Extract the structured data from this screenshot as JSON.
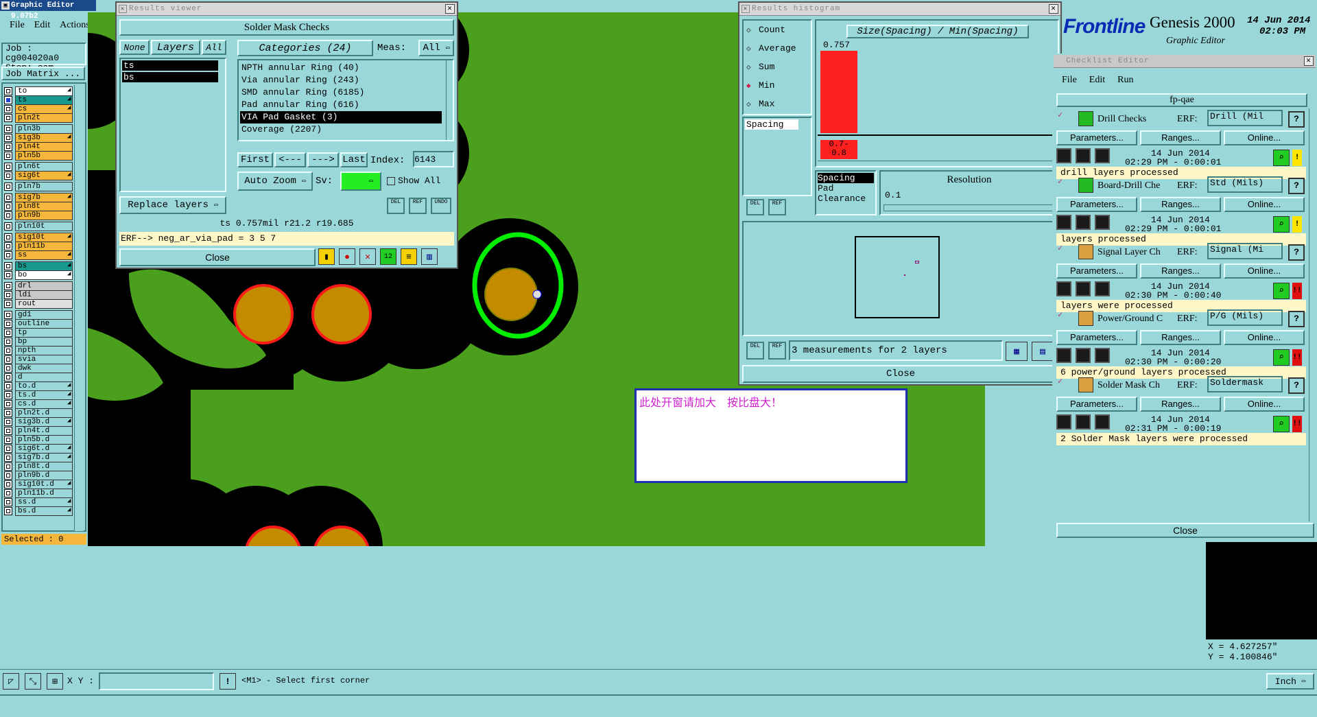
{
  "main_window": {
    "title": "Graphic Editor 9.07b2",
    "menu": [
      "File",
      "Edit",
      "Actions"
    ],
    "job_label": "Job : cg004020a0",
    "step_label": "Step: cam",
    "job_matrix_button": "Job Matrix ...",
    "selected_text": "Selected : 0",
    "layers": [
      {
        "name": "to",
        "bg": "#ffffff",
        "arrow": true
      },
      {
        "name": "ts",
        "bg": "#199a8f",
        "arrow": true,
        "active": true
      },
      {
        "name": "cs",
        "bg": "#f5b73b",
        "arrow": true
      },
      {
        "name": "pln2t",
        "bg": "#f5b73b",
        "arrow": false
      },
      {
        "name": "pln3b",
        "bg": "#9ad7d9",
        "arrow": false
      },
      {
        "name": "sig3b",
        "bg": "#f5b73b",
        "arrow": true
      },
      {
        "name": "pln4t",
        "bg": "#f5b73b",
        "arrow": false
      },
      {
        "name": "pln5b",
        "bg": "#f5b73b",
        "arrow": false
      },
      {
        "name": "pln6t",
        "bg": "#9ad7d9",
        "arrow": false
      },
      {
        "name": "sig6t",
        "bg": "#f5b73b",
        "arrow": true
      },
      {
        "name": "pln7b",
        "bg": "#9ad7d9",
        "arrow": false
      },
      {
        "name": "sig7b",
        "bg": "#f5b73b",
        "arrow": true
      },
      {
        "name": "pln8t",
        "bg": "#f5b73b",
        "arrow": false
      },
      {
        "name": "pln9b",
        "bg": "#f5b73b",
        "arrow": false
      },
      {
        "name": "pln10t",
        "bg": "#9ad7d9",
        "arrow": false
      },
      {
        "name": "sig10t",
        "bg": "#f5b73b",
        "arrow": true
      },
      {
        "name": "pln11b",
        "bg": "#f5b73b",
        "arrow": false
      },
      {
        "name": "ss",
        "bg": "#f5b73b",
        "arrow": true
      },
      {
        "name": "bs",
        "bg": "#199a8f",
        "arrow": true
      },
      {
        "name": "bo",
        "bg": "#ffffff",
        "arrow": true
      },
      {
        "name": "drl",
        "bg": "#c8c8c8",
        "arrow": false
      },
      {
        "name": "ldi",
        "bg": "#c8c8c8",
        "arrow": false
      },
      {
        "name": "rout",
        "bg": "#e0e0e0",
        "arrow": false
      },
      {
        "name": "gd1",
        "bg": "#9ad7d9",
        "arrow": false
      },
      {
        "name": "outline",
        "bg": "#9ad7d9",
        "arrow": false
      },
      {
        "name": "tp",
        "bg": "#9ad7d9",
        "arrow": false
      },
      {
        "name": "bp",
        "bg": "#9ad7d9",
        "arrow": false
      },
      {
        "name": "npth",
        "bg": "#9ad7d9",
        "arrow": false
      },
      {
        "name": "svia",
        "bg": "#9ad7d9",
        "arrow": false
      },
      {
        "name": "dwk",
        "bg": "#9ad7d9",
        "arrow": false
      },
      {
        "name": "d",
        "bg": "#9ad7d9",
        "arrow": false
      },
      {
        "name": "to.d",
        "bg": "#9ad7d9",
        "arrow": true
      },
      {
        "name": "ts.d",
        "bg": "#9ad7d9",
        "arrow": true
      },
      {
        "name": "cs.d",
        "bg": "#9ad7d9",
        "arrow": true
      },
      {
        "name": "pln2t.d",
        "bg": "#9ad7d9",
        "arrow": false
      },
      {
        "name": "sig3b.d",
        "bg": "#9ad7d9",
        "arrow": true
      },
      {
        "name": "pln4t.d",
        "bg": "#9ad7d9",
        "arrow": false
      },
      {
        "name": "pln5b.d",
        "bg": "#9ad7d9",
        "arrow": false
      },
      {
        "name": "sig6t.d",
        "bg": "#9ad7d9",
        "arrow": true
      },
      {
        "name": "sig7b.d",
        "bg": "#9ad7d9",
        "arrow": true
      },
      {
        "name": "pln8t.d",
        "bg": "#9ad7d9",
        "arrow": false
      },
      {
        "name": "pln9b.d",
        "bg": "#9ad7d9",
        "arrow": false
      },
      {
        "name": "sig10t.d",
        "bg": "#9ad7d9",
        "arrow": true
      },
      {
        "name": "pln11b.d",
        "bg": "#9ad7d9",
        "arrow": false
      },
      {
        "name": "ss.d",
        "bg": "#9ad7d9",
        "arrow": true
      },
      {
        "name": "bs.d",
        "bg": "#9ad7d9",
        "arrow": true
      }
    ]
  },
  "bottom_bar": {
    "xy_label": "X Y :",
    "xy_value": "",
    "prompt": "<M1> - Select first corner",
    "units": "Inch"
  },
  "coords": {
    "x": "X = 4.627257\"",
    "y": "Y = 4.100846\""
  },
  "brand": {
    "logo": "Frontline",
    "product": "Genesis 2000",
    "subtitle": "Graphic Editor",
    "date": "14 Jun 2014",
    "time": "02:03 PM"
  },
  "annotation": "此处开窗请加大　按比盘大！",
  "results_viewer": {
    "title": "Results viewer",
    "heading": "Solder Mask Checks",
    "none_btn": "None",
    "layers_btn": "Layers",
    "all_btn": "All",
    "categories_label": "Categories (24)",
    "meas_label": "Meas:",
    "meas_value": "All",
    "layer_list": [
      "ts",
      "bs"
    ],
    "categories": [
      "NPTH annular Ring (40)",
      "Via annular Ring (243)",
      "SMD annular Ring (6185)",
      "Pad annular Ring (616)",
      "VIA Pad Gasket (3)",
      "Coverage (2207)"
    ],
    "selected_category": 4,
    "replace_layers": "Replace layers",
    "first": "First",
    "prev": "<---",
    "next": "--->",
    "last": "Last",
    "index_label": "Index:",
    "index_value": "6143",
    "auto_zoom": "Auto Zoom",
    "sv_label": "Sv:",
    "show_all": "Show All",
    "icon_labels": [
      "DEL",
      "REF",
      "UNDO"
    ],
    "status": "ts 0.757mil   r21.2  r19.685",
    "erf": "ERF--> neg_ar_via_pad = 3 5 7",
    "close": "Close"
  },
  "histogram": {
    "title": "Results histogram",
    "options": [
      "Count",
      "Average",
      "Sum",
      "Min",
      "Max"
    ],
    "selected_option": "Min",
    "chart_title": "Size(Spacing) / Min(Spacing)",
    "bar_value": "0.757",
    "bar_range": "0.7-\n0.8",
    "left_list": [
      "Spacing"
    ],
    "size_list": [
      "Spacing",
      "Pad",
      "Clearance"
    ],
    "resolution_label": "Resolution",
    "resolution_value": "0.1",
    "measurements": "3 measurements for 2 layers",
    "icon_labels": [
      "DEL",
      "REF"
    ],
    "close": "Close",
    "bar_color": "#ff2020"
  },
  "checklist": {
    "title": "Checklist Editor",
    "menu": [
      "File",
      "Edit",
      "Run"
    ],
    "name": "fp-qae",
    "erf_label": "ERF:",
    "params": "Parameters...",
    "ranges": "Ranges...",
    "online": "Online...",
    "items": [
      {
        "name": "Drill Checks",
        "erf": "Drill (Mil",
        "date": "14 Jun 2014",
        "time": "02:29 PM - 0:00:01",
        "msg": "drill layers processed",
        "flag": "!",
        "flag_color": "#ffe600"
      },
      {
        "name": "Board-Drill Che",
        "erf": "Std (Mils)",
        "date": "14 Jun 2014",
        "time": "02:29 PM - 0:00:01",
        "msg": "layers processed",
        "flag": "!",
        "flag_color": "#ffe600"
      },
      {
        "name": "Signal Layer Ch",
        "erf": "Signal (Mi",
        "date": "14 Jun 2014",
        "time": "02:30 PM - 0:00:40",
        "msg": "layers were processed",
        "flag": "!!",
        "flag_color": "#e01010"
      },
      {
        "name": "Power/Ground C",
        "erf": "P/G (Mils)",
        "date": "14 Jun 2014",
        "time": "02:30 PM - 0:00:20",
        "msg": "6 power/ground layers processed",
        "flag": "!!",
        "flag_color": "#e01010"
      },
      {
        "name": "Solder Mask Ch",
        "erf": "Soldermask",
        "date": "14 Jun 2014",
        "time": "02:31 PM - 0:00:19",
        "msg": "2 Solder Mask layers were processed",
        "flag": "!!",
        "flag_color": "#e01010"
      }
    ],
    "close": "Close"
  }
}
